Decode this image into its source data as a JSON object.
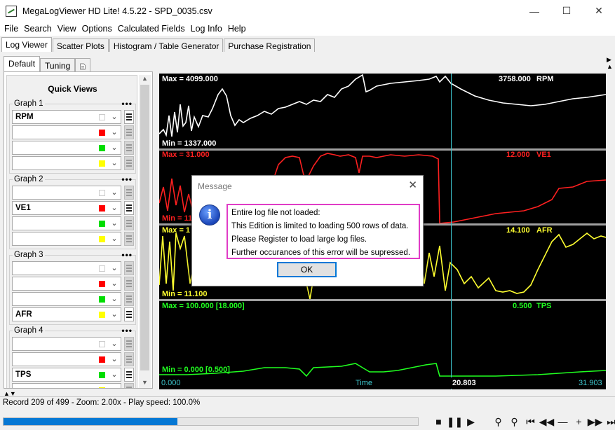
{
  "window": {
    "title": "MegaLogViewer HD Lite! 4.5.22 - SPD_0035.csv",
    "minimize_glyph": "—",
    "maximize_glyph": "☐",
    "close_glyph": "✕"
  },
  "menu": [
    "File",
    "Search",
    "View",
    "Options",
    "Calculated Fields",
    "Log Info",
    "Help"
  ],
  "main_tabs": [
    "Log Viewer",
    "Scatter Plots",
    "Histogram / Table Generator",
    "Purchase Registration"
  ],
  "left_tabs": [
    "Default",
    "Tuning"
  ],
  "quick_views": {
    "title": "Quick Views",
    "groups": [
      {
        "label": "Graph 1",
        "rows": [
          {
            "field": "RPM",
            "color": "#ffffff",
            "active": true
          },
          {
            "field": "",
            "color": "#ff0000",
            "active": false
          },
          {
            "field": "",
            "color": "#00dd00",
            "active": false
          },
          {
            "field": "",
            "color": "#ffff00",
            "active": false
          }
        ]
      },
      {
        "label": "Graph 2",
        "rows": [
          {
            "field": "",
            "color": "#ffffff",
            "active": false
          },
          {
            "field": "VE1",
            "color": "#ff0000",
            "active": true
          },
          {
            "field": "",
            "color": "#00dd00",
            "active": false
          },
          {
            "field": "",
            "color": "#ffff00",
            "active": false
          }
        ]
      },
      {
        "label": "Graph 3",
        "rows": [
          {
            "field": "",
            "color": "#ffffff",
            "active": false
          },
          {
            "field": "",
            "color": "#ff0000",
            "active": false
          },
          {
            "field": "",
            "color": "#00dd00",
            "active": false
          },
          {
            "field": "AFR",
            "color": "#ffff00",
            "active": true
          }
        ]
      },
      {
        "label": "Graph 4",
        "rows": [
          {
            "field": "",
            "color": "#ffffff",
            "active": false
          },
          {
            "field": "",
            "color": "#ff0000",
            "active": false
          },
          {
            "field": "TPS",
            "color": "#00dd00",
            "active": true
          },
          {
            "field": "",
            "color": "#ffff00",
            "active": false
          }
        ]
      }
    ]
  },
  "graphs": {
    "rpm": {
      "max": "Max = 4099.000",
      "min": "Min = 1337.000",
      "current": "3758.000",
      "name": "RPM",
      "color": "#ffffff"
    },
    "ve1": {
      "max": "Max = 31.000",
      "min": "Min = 11",
      "current": "12.000",
      "name": "VE1",
      "color": "#ff2020"
    },
    "afr": {
      "max": "Max = 1",
      "min": "Min = 11.100",
      "current": "14.100",
      "name": "AFR",
      "color": "#ffff30"
    },
    "tps": {
      "max": "Max = 100.000 [18.000]",
      "min": "Min = 0.000 [0.500]",
      "current": "0.500",
      "name": "TPS",
      "color": "#20ff20"
    }
  },
  "time_axis": {
    "start": "0.000",
    "label": "Time",
    "cursor": "20.803",
    "end": "31.903"
  },
  "status": "Record 209 of 499 - Zoom: 2.00x - Play speed: 100.0%",
  "progress": 0.42,
  "dialog": {
    "title": "Message",
    "lines": [
      "Entire log file not loaded:",
      "This Edition is limited to loading 500 rows of data.",
      "Please Register to load large log files.",
      "Further occurances of this error will be supressed."
    ],
    "ok_label": "OK",
    "icon_glyph": "i",
    "close_glyph": "✕"
  },
  "accent_color": "#0678d4",
  "highlight_color": "#e03cc6"
}
